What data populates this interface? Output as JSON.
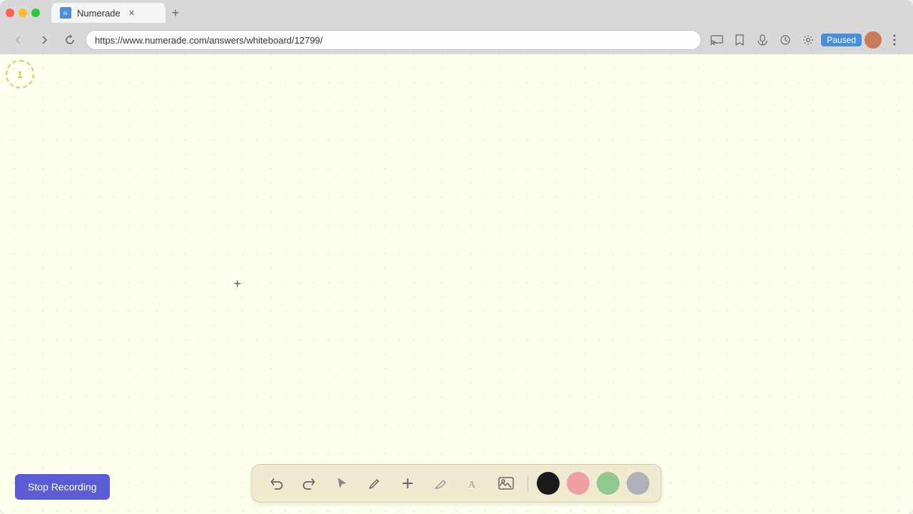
{
  "browser": {
    "title": "Numerade",
    "url": "https://www.numerade.com/answers/whiteboard/12799/",
    "tab_label": "Numerade",
    "paused_label": "Paused"
  },
  "nav": {
    "back_label": "‹",
    "forward_label": "›",
    "refresh_label": "↻"
  },
  "whiteboard": {
    "page_number": "1",
    "cursor_symbol": "+"
  },
  "toolbar": {
    "undo_label": "↺",
    "redo_label": "↻",
    "select_label": "▶",
    "pen_label": "✏",
    "add_label": "+",
    "eraser_label": "/",
    "text_label": "A",
    "image_label": "🖼",
    "stop_recording_label": "Stop Recording"
  },
  "colors": {
    "black": "#1a1a1a",
    "pink": "#f0a0a0",
    "green": "#90c890",
    "gray": "#b0b0b8"
  }
}
